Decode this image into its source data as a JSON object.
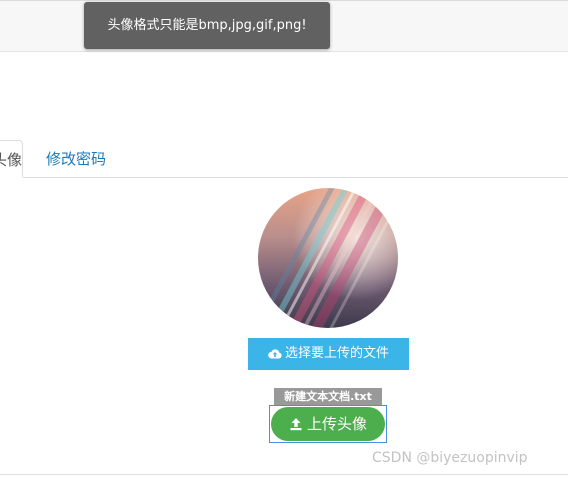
{
  "toast": {
    "message": "头像格式只能是bmp,jpg,gif,png!"
  },
  "tabs": {
    "active_label": "修改头像",
    "second_label": "修改密码"
  },
  "upload": {
    "choose_icon": "cloud-upload-icon",
    "choose_label": "选择要上传的文件",
    "selected_file": "新建文本文档.txt",
    "upload_icon": "upload-icon",
    "upload_label": "上传头像"
  },
  "watermark": "CSDN @biyezuopinvip",
  "colors": {
    "toast_bg": "#616161",
    "choose_button": "#3bb4e8",
    "upload_button": "#4cae4c",
    "link": "#1a7bb6"
  }
}
